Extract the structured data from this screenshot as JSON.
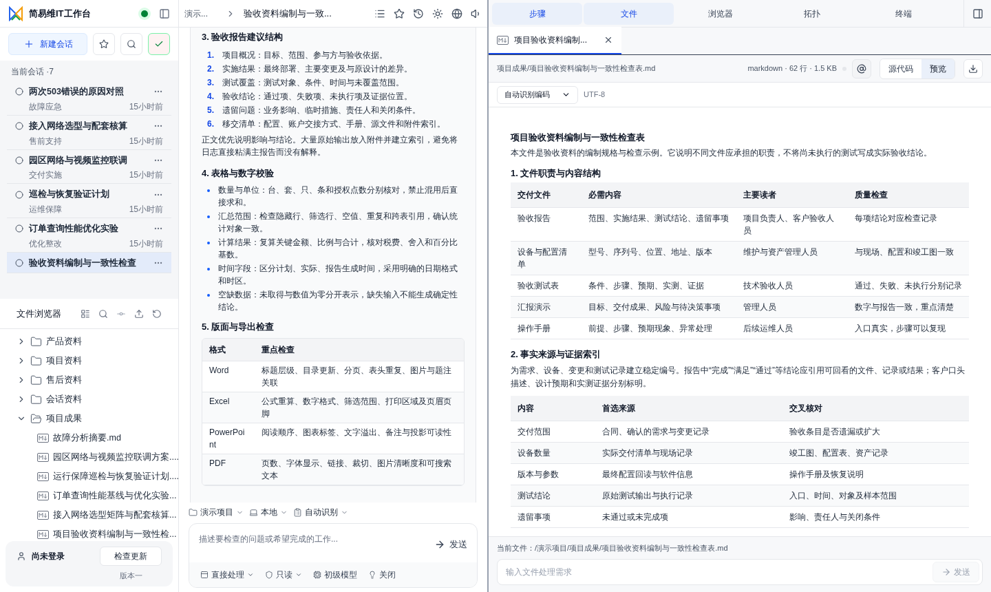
{
  "app": {
    "title": "简易维IT工作台",
    "online": true
  },
  "sidebar": {
    "new_chat": "新建会话",
    "check_mode_on": true,
    "sessions_label": "当前会话 ·7",
    "sessions": [
      {
        "title": "两次503错误的原因对照",
        "tag": "故障应急",
        "time": "15小时前",
        "selected": false
      },
      {
        "title": "接入网络选型与配套核算",
        "tag": "售前支持",
        "time": "15小时前",
        "selected": false
      },
      {
        "title": "园区网络与视频监控联调",
        "tag": "交付实施",
        "time": "15小时前",
        "selected": false
      },
      {
        "title": "巡检与恢复验证计划",
        "tag": "运维保障",
        "time": "15小时前",
        "selected": false
      },
      {
        "title": "订单查询性能优化实验",
        "tag": "优化整改",
        "time": "15小时前",
        "selected": false
      },
      {
        "title": "验收资料编制与一致性检查",
        "selected": true
      }
    ]
  },
  "file_browser": {
    "title": "文件浏览器",
    "tree": [
      {
        "name": "产品资料",
        "kind": "folder",
        "expanded": false
      },
      {
        "name": "项目资料",
        "kind": "folder",
        "expanded": false
      },
      {
        "name": "售后资料",
        "kind": "folder",
        "expanded": false
      },
      {
        "name": "会话资料",
        "kind": "folder",
        "expanded": false
      },
      {
        "name": "项目成果",
        "kind": "folder",
        "expanded": true,
        "children": [
          {
            "name": "故障分析摘要.md",
            "kind": "markdown"
          },
          {
            "name": "园区网络与视频监控联调方案....",
            "kind": "markdown"
          },
          {
            "name": "运行保障巡检与恢复验证计划....",
            "kind": "markdown"
          },
          {
            "name": "订单查询性能基线与优化实验...",
            "kind": "markdown"
          },
          {
            "name": "接入网络选型矩阵与配套核算...",
            "kind": "markdown"
          },
          {
            "name": "项目验收资料编制与一致性检...",
            "kind": "markdown"
          }
        ]
      }
    ]
  },
  "account": {
    "status": "尚未登录",
    "update_button": "检查更新",
    "version": "版本一"
  },
  "editor": {
    "breadcrumb": [
      "演示...",
      "验收资料编制与一致..."
    ],
    "blocks": [
      {
        "kind": "heading",
        "text": "3. 验收报告建议结构"
      },
      {
        "kind": "ordered",
        "items": [
          {
            "number": "1.",
            "text": "项目概况：目标、范围、参与方与验收依据。"
          },
          {
            "number": "2.",
            "text": "实施结果：最终部署、主要变更及与原设计的差异。"
          },
          {
            "number": "3.",
            "text": "测试覆盖：测试对象、条件、时间与未覆盖范围。"
          },
          {
            "number": "4.",
            "text": "验收结论：通过项、失败项、未执行项及证据位置。"
          },
          {
            "number": "5.",
            "text": "遗留问题：业务影响、临时措施、责任人和关闭条件。"
          },
          {
            "number": "6.",
            "text": "移交清单：配置、账户交接方式、手册、源文件和附件索引。"
          }
        ]
      },
      {
        "kind": "paragraph",
        "text": "正文优先说明影响与结论。大量原始输出放入附件并建立索引，避免将日志直接粘满主报告而没有解释。"
      },
      {
        "kind": "heading",
        "text": "4. 表格与数字校验"
      },
      {
        "kind": "bullets",
        "items": [
          "数量与单位：台、套、只、条和授权点数分别核对，禁止混用后直接求和。",
          "汇总范围：检查隐藏行、筛选行、空值、重复和跨表引用，确认统计对象一致。",
          "计算结果：复算关键金额、比例与合计，核对税费、舍入和百分比基数。",
          "时间字段：区分计划、实际、报告生成时间，采用明确的日期格式和时区。",
          "空缺数据：未取得与数值为零分开表示，缺失输入不能生成确定性结论。"
        ]
      },
      {
        "kind": "heading",
        "text": "5. 版面与导出检查"
      },
      {
        "kind": "table",
        "columns": [
          "格式",
          "重点检查"
        ],
        "rows": [
          [
            "Word",
            "标题层级、目录更新、分页、表头重复、图片与题注关联"
          ],
          [
            "Excel",
            "公式重算、数字格式、筛选范围、打印区域及页眉页脚"
          ],
          [
            "PowerPoint",
            "阅读顺序、图表标签、文字溢出、备注与投影可读性"
          ],
          [
            "PDF",
            "页数、字体显示、链接、裁切、图片清晰度和可搜索文本"
          ]
        ]
      }
    ]
  },
  "composer": {
    "context": [
      "演示项目",
      "本地",
      "自动识别"
    ],
    "placeholder": "描述要检查的问题或希望完成的工作...",
    "send": "发送",
    "options": [
      {
        "label": "直接处理",
        "dropdown": true
      },
      {
        "label": "只读",
        "dropdown": true
      },
      {
        "label": "初级模型",
        "dropdown": false
      },
      {
        "label": "关闭",
        "dropdown": false
      }
    ]
  },
  "right": {
    "tabs": [
      {
        "label": "步骤",
        "selected": true
      },
      {
        "label": "文件",
        "selected": true
      },
      {
        "label": "浏览器",
        "selected": false
      },
      {
        "label": "拓扑",
        "selected": false
      },
      {
        "label": "终端",
        "selected": false
      }
    ],
    "file_tab": {
      "title": "项目验收资料编制...",
      "active": true
    },
    "path": "项目成果/项目验收资料编制与一致性检查表.md",
    "meta": "markdown · 62 行 · 1.5 KB",
    "view_modes": [
      {
        "label": "源代码",
        "selected": false
      },
      {
        "label": "预览",
        "selected": true
      }
    ],
    "encoding": {
      "value": "自动识别编码",
      "detected": "UTF-8"
    },
    "preview": {
      "title": "项目验收资料编制与一致性检查表",
      "intro": "本文件是验收资料的编制规格与检查示例。它说明不同文件应承担的职责，不将尚未执行的测试写成实际验收结论。",
      "sections": [
        {
          "heading": "1. 文件职责与内容结构",
          "table": {
            "columns": [
              "交付文件",
              "必需内容",
              "主要读者",
              "质量检查"
            ],
            "rows": [
              [
                "验收报告",
                "范围、实施结果、测试结论、遗留事项",
                "项目负责人、客户验收人员",
                "每项结论对应检查记录"
              ],
              [
                "设备与配置清单",
                "型号、序列号、位置、地址、版本",
                "维护与资产管理人员",
                "与现场、配置和竣工图一致"
              ],
              [
                "验收测试表",
                "条件、步骤、预期、实测、证据",
                "技术验收人员",
                "通过、失败、未执行分别记录"
              ],
              [
                "汇报演示",
                "目标、交付成果、风险与待决策事项",
                "管理人员",
                "数字与报告一致，重点清楚"
              ],
              [
                "操作手册",
                "前提、步骤、预期现象、异常处理",
                "后续运维人员",
                "入口真实，步骤可以复现"
              ]
            ]
          }
        },
        {
          "heading": "2. 事实来源与证据索引",
          "text": "为需求、设备、变更和测试记录建立稳定编号。报告中“完成”“满足”“通过”等结论应引用可回看的文件、记录或结果；客户口头描述、设计预期和实测证据分别标明。",
          "table": {
            "columns": [
              "内容",
              "首选来源",
              "交叉核对"
            ],
            "rows": [
              [
                "交付范围",
                "合同、确认的需求与变更记录",
                "验收条目是否遗漏或扩大"
              ],
              [
                "设备数量",
                "实际交付清单与现场记录",
                "竣工图、配置表、资产记录"
              ],
              [
                "版本与参数",
                "最终配置回读与软件信息",
                "操作手册及恢复说明"
              ],
              [
                "测试结论",
                "原始测试输出与执行记录",
                "入口、时间、对象及样本范围"
              ],
              [
                "遗留事项",
                "未通过或未完成项",
                "影响、责任人与关闭条件"
              ]
            ]
          }
        }
      ]
    },
    "footer": {
      "current_file": "当前文件：/演示项目/项目成果/项目验收资料编制与一致性检查表.md",
      "placeholder": "输入文件处理需求",
      "send": "发送",
      "send_disabled": true
    }
  }
}
